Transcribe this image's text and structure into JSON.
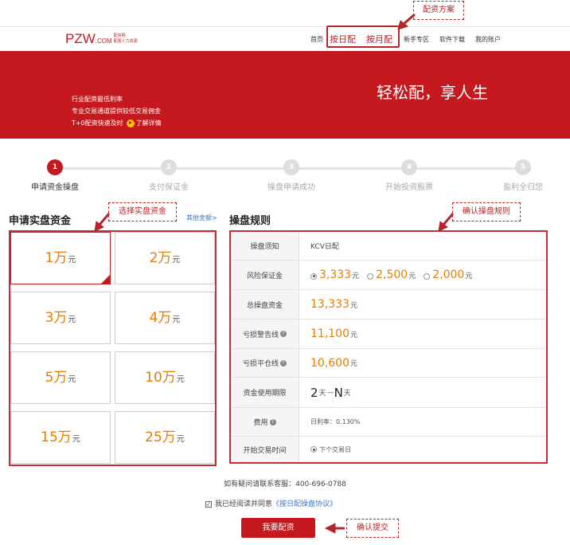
{
  "nav": {
    "logo_main": "PZW",
    "logo_com": ".COM",
    "logo_sub_top": "配资网",
    "logo_sub_bottom": "配置人力资源",
    "items": [
      "首页",
      "按日配",
      "按月配",
      "新手专区",
      "软件下载",
      "我的账户"
    ]
  },
  "banner": {
    "line1": "行业配资最低利率",
    "line2": "专业交易通道提供较低交易佣金",
    "line3": "T+0配资快速及时",
    "detail_link": "了解详情",
    "slogan": "轻松配，享人生"
  },
  "steps": [
    {
      "num": "1",
      "label": "申请资金操盘"
    },
    {
      "num": "2",
      "label": "支付保证金"
    },
    {
      "num": "3",
      "label": "操盘申请成功"
    },
    {
      "num": "4",
      "label": "开始投资股票"
    },
    {
      "num": "5",
      "label": "盈利全归您"
    }
  ],
  "left": {
    "title": "申请实盘资金",
    "other_amount": "其他金额>",
    "amounts": [
      {
        "num": "1万",
        "unit": "元"
      },
      {
        "num": "2万",
        "unit": "元"
      },
      {
        "num": "3万",
        "unit": "元"
      },
      {
        "num": "4万",
        "unit": "元"
      },
      {
        "num": "5万",
        "unit": "元"
      },
      {
        "num": "10万",
        "unit": "元"
      },
      {
        "num": "15万",
        "unit": "元"
      },
      {
        "num": "25万",
        "unit": "元"
      }
    ]
  },
  "rules": {
    "title": "操盘规则",
    "rows": {
      "notice": {
        "label": "操盘须知",
        "value": "KCV日配"
      },
      "margin": {
        "label": "风险保证金",
        "opt1": "3,333",
        "opt2": "2,500",
        "opt3": "2,000",
        "unit": "元"
      },
      "total": {
        "label": "总操盘资金",
        "value": "13,333",
        "unit": "元"
      },
      "warn": {
        "label": "亏损警告线",
        "value": "11,100",
        "unit": "元"
      },
      "close": {
        "label": "亏损平仓线",
        "value": "10,600",
        "unit": "元"
      },
      "period": {
        "label": "资金使用期限",
        "a": "2",
        "a_unit": "天",
        "sep": "—",
        "b": "N",
        "b_unit": "天"
      },
      "fee": {
        "label": "费用",
        "value": "日利率：0.130%"
      },
      "start": {
        "label": "开始交易时间",
        "value": "下个交易日"
      }
    }
  },
  "footer": {
    "contact": "如有疑问请联系客服：400-696-0788",
    "agree_text": "我已经阅读并同意",
    "agree_link": "《按日配操盘协议》",
    "submit": "我要配资"
  },
  "callouts": {
    "plan": "配资方案",
    "select": "选择实盘资金",
    "confirm_rules": "确认操盘规则",
    "confirm_submit": "确认提交"
  },
  "colors": {
    "brand": "#c41a1f",
    "accent": "#e87c00",
    "link": "#3a74c9"
  }
}
